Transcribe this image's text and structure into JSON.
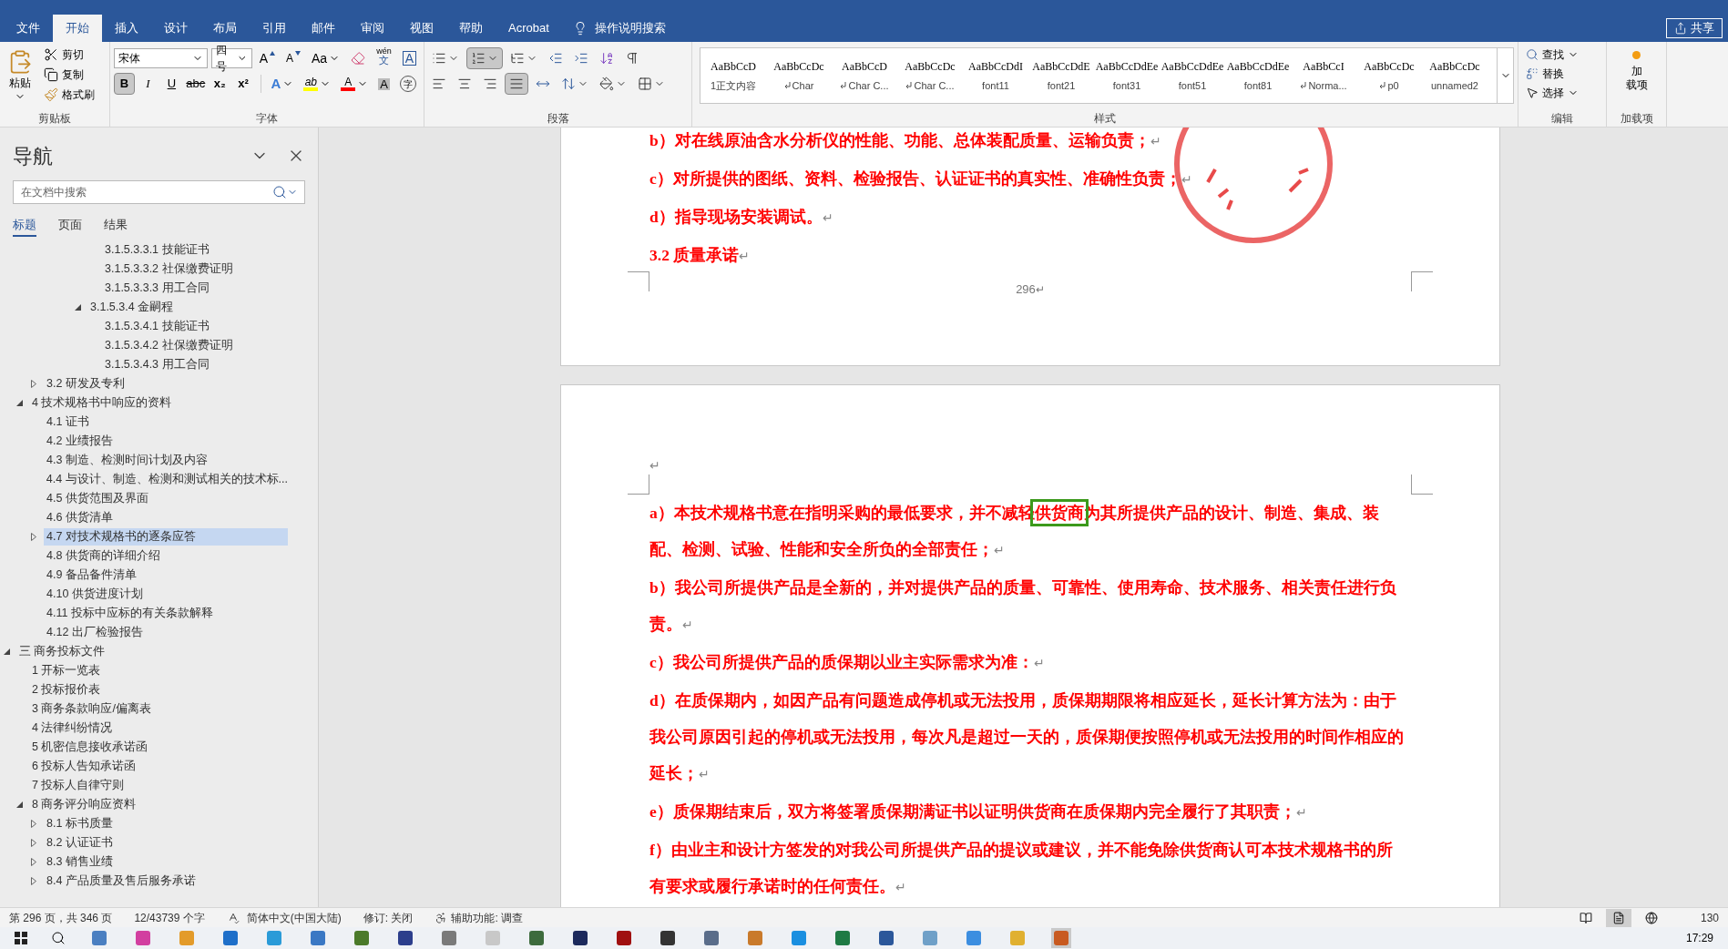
{
  "ribbon": {
    "tabs": [
      {
        "label": "文件",
        "selected": false
      },
      {
        "label": "开始",
        "selected": true
      },
      {
        "label": "插入",
        "selected": false
      },
      {
        "label": "设计",
        "selected": false
      },
      {
        "label": "布局",
        "selected": false
      },
      {
        "label": "引用",
        "selected": false
      },
      {
        "label": "邮件",
        "selected": false
      },
      {
        "label": "审阅",
        "selected": false
      },
      {
        "label": "视图",
        "selected": false
      },
      {
        "label": "帮助",
        "selected": false
      },
      {
        "label": "Acrobat",
        "selected": false
      }
    ],
    "tell_me": "操作说明搜索",
    "share": "共享",
    "clipboard": {
      "paste": "粘贴",
      "cut": "剪切",
      "copy": "复制",
      "format_painter": "格式刷",
      "label": "剪贴板"
    },
    "font": {
      "name": "宋体",
      "size": "四号",
      "grow": "A",
      "shrink": "A",
      "case": "Aa",
      "phonetic_top": "wén",
      "phonetic_bottom": "文",
      "boxed": "A",
      "label": "字体",
      "format_buttons": [
        {
          "kind": "bold",
          "glyph": "B",
          "selected": true
        },
        {
          "kind": "italic",
          "glyph": "I",
          "selected": false
        },
        {
          "kind": "underline",
          "glyph": "U",
          "selected": false
        },
        {
          "kind": "strike",
          "glyph": "abc",
          "selected": false
        },
        {
          "kind": "sub",
          "glyph": "x₂",
          "selected": false
        },
        {
          "kind": "sup",
          "glyph": "x²",
          "selected": false
        }
      ],
      "effects": [
        {
          "kind": "effect",
          "glyph": "A"
        },
        {
          "kind": "highlight",
          "glyph": "ab",
          "color": "#ffff00"
        },
        {
          "kind": "fontcolor",
          "glyph": "A",
          "color": "#ff0000"
        },
        {
          "kind": "shade",
          "glyph": "A"
        },
        {
          "kind": "enclose",
          "glyph": "字"
        }
      ]
    },
    "paragraph": {
      "label": "段落",
      "numbering_selected": true,
      "justify_selected": true
    },
    "styles": {
      "label": "样式",
      "items": [
        {
          "preview": "AaBbCcD",
          "name": "1正文内容",
          "linked": false
        },
        {
          "preview": "AaBbCcDc",
          "name": "Char",
          "linked": true
        },
        {
          "preview": "AaBbCcD",
          "name": "Char C...",
          "linked": true
        },
        {
          "preview": "AaBbCcDc",
          "name": "Char C...",
          "linked": true
        },
        {
          "preview": "AaBbCcDdI",
          "name": "font11",
          "linked": false
        },
        {
          "preview": "AaBbCcDdE",
          "name": "font21",
          "linked": false
        },
        {
          "preview": "AaBbCcDdEe",
          "name": "font31",
          "linked": false
        },
        {
          "preview": "AaBbCcDdEe",
          "name": "font51",
          "linked": false
        },
        {
          "preview": "AaBbCcDdEe",
          "name": "font81",
          "linked": false
        },
        {
          "preview": "AaBbCcI",
          "name": "Norma...",
          "linked": true
        },
        {
          "preview": "AaBbCcDc",
          "name": "p0",
          "linked": true
        },
        {
          "preview": "AaBbCcDc",
          "name": "unnamed2",
          "linked": false
        }
      ]
    },
    "editing": {
      "find": "查找",
      "replace": "替换",
      "select": "选择",
      "label": "编辑"
    },
    "addins": {
      "button_top": "加",
      "button_bottom": "载项",
      "label": "加载项"
    }
  },
  "nav": {
    "title": "导航",
    "search": {
      "placeholder": "在文档中搜索"
    },
    "tabs": [
      {
        "label": "标题",
        "selected": true
      },
      {
        "label": "页面",
        "selected": false
      },
      {
        "label": "结果",
        "selected": false
      }
    ],
    "tree": [
      {
        "children": [
          {
            "children": [
              {
                "children": [
                  {
                    "children": [
                      {
                        "children": [
                          {
                            "children": [
                              {
                                "label": "3.1.5.3.3.1 技能证书",
                                "selected": false
                              },
                              {
                                "label": "3.1.5.3.3.2 社保缴费证明",
                                "selected": false
                              },
                              {
                                "label": "3.1.5.3.3.3  用工合同",
                                "selected": false
                              }
                            ]
                          },
                          {
                            "label": "3.1.5.3.4 金嗣程",
                            "selected": false,
                            "expanded": true,
                            "children": [
                              {
                                "label": "3.1.5.3.4.1 技能证书",
                                "selected": false
                              },
                              {
                                "label": "3.1.5.3.4.2 社保缴费证明",
                                "selected": false
                              },
                              {
                                "label": "3.1.5.3.4.3 用工合同",
                                "selected": false
                              }
                            ]
                          }
                        ]
                      }
                    ]
                  }
                ]
              },
              {
                "label": "3.2 研发及专利",
                "selected": false,
                "expanded": false
              }
            ]
          },
          {
            "label": "4 技术规格书中响应的资料",
            "selected": false,
            "expanded": true,
            "children": [
              {
                "label": "4.1 证书",
                "selected": false
              },
              {
                "label": "4.2 业绩报告",
                "selected": false
              },
              {
                "label": "4.3 制造、检测时间计划及内容",
                "selected": false
              },
              {
                "label": "4.4 与设计、制造、检测和测试相关的技术标...",
                "selected": false
              },
              {
                "label": "4.5 供货范围及界面",
                "selected": false
              },
              {
                "label": "4.6 供货清单",
                "selected": false
              },
              {
                "label": "4.7 对技术规格书的逐条应答",
                "selected": true,
                "expanded": false
              },
              {
                "label": "4.8 供货商的详细介绍",
                "selected": false
              },
              {
                "label": "4.9 备品备件清单",
                "selected": false
              },
              {
                "label": "4.10 供货进度计划",
                "selected": false
              },
              {
                "label": "4.11 投标中应标的有关条款解释",
                "selected": false
              },
              {
                "label": "4.12 出厂检验报告",
                "selected": false
              }
            ]
          }
        ]
      },
      {
        "label": "三 商务投标文件",
        "selected": false,
        "expanded": true,
        "children": [
          {
            "label": "1 开标一览表",
            "selected": false
          },
          {
            "label": "2 投标报价表",
            "selected": false
          },
          {
            "label": "3 商务条款响应/偏离表",
            "selected": false
          },
          {
            "label": "4 法律纠纷情况",
            "selected": false
          },
          {
            "label": "5 机密信息接收承诺函",
            "selected": false
          },
          {
            "label": "6 投标人告知承诺函",
            "selected": false
          },
          {
            "label": "7 投标人自律守则",
            "selected": false
          },
          {
            "label": "8 商务评分响应资料",
            "selected": false,
            "expanded": true,
            "children": [
              {
                "label": "8.1 标书质量",
                "selected": false,
                "expanded": false
              },
              {
                "label": "8.2 认证证书",
                "selected": false,
                "expanded": false
              },
              {
                "label": "8.3 销售业绩",
                "selected": false,
                "expanded": false
              },
              {
                "label": "8.4 产品质量及售后服务承诺",
                "selected": false,
                "expanded": false
              }
            ]
          }
        ]
      }
    ]
  },
  "document": {
    "page_prev": {
      "paragraphs": [
        {
          "before": "b）对在线原油含水分析仪的性能、功能、总体装配质量、运输负责；",
          "end_mark": "↵"
        },
        {
          "before": "c）对所提供的图纸、资料、检验报告、认证证书的真实性、准确性负责；",
          "end_mark": "↵"
        },
        {
          "before": "d）指导现场安装调试。",
          "end_mark": "↵"
        },
        {
          "before": "3.2 质量承诺",
          "end_mark": "↵"
        }
      ],
      "page_number": "296",
      "page_number_mark": "↵"
    },
    "page_next": {
      "empty_mark": "↵",
      "paragraphs": [
        {
          "before": "a）本技术规格书意在指明采购的最低要求，并不减轻",
          "boxed": "供货商",
          "after": "为其所提供产品的设计、制造、集成、装配、检测、试验、性能和安全所负的全部责任；",
          "end_mark": "↵"
        },
        {
          "before": "b）我公司所提供产品是全新的，并对提供产品的质量、可靠性、使用寿命、技术服务、相关责任进行负责。",
          "end_mark": "↵"
        },
        {
          "before": "c）我公司所提供产品的质保期以业主实际需求为准：",
          "end_mark": "↵"
        },
        {
          "before": "d）在质保期内，如因产品有问题造成停机或无法投用，质保期期限将相应延长，延长计算方法为：由于我公司原因引起的停机或无法投用，每次凡是超过一天的，质保期便按照停机或无法投用的时间作相应的延长；",
          "end_mark": "↵"
        },
        {
          "before": "e）质保期结束后，双方将签署质保期满证书以证明供货商在质保期内完全履行了其职责；",
          "end_mark": "↵"
        },
        {
          "before": "f）由业主和设计方签发的对我公司所提供产品的提议或建议，并不能免除供货商认可本技术规格书的所有要求或履行承诺时的任何责任。",
          "end_mark": "↵"
        }
      ]
    }
  },
  "status_bar": {
    "page": "第 296 页，共 346 页",
    "words": "12/43739 个字",
    "language": "简体中文(中国大陆)",
    "track_changes": "修订: 关闭",
    "accessibility": "辅助功能: 调查",
    "zoom": "130",
    "views": [
      {
        "kind": "read",
        "selected": false
      },
      {
        "kind": "print",
        "selected": true
      },
      {
        "kind": "web",
        "selected": false
      }
    ]
  },
  "taskbar": {
    "time": "17:29",
    "apps": [
      {
        "color": "#4a7fc1",
        "selected": false
      },
      {
        "color": "#d23fa0",
        "selected": false
      },
      {
        "color": "#e39b2a",
        "selected": false
      },
      {
        "color": "#1e6fc9",
        "selected": false
      },
      {
        "color": "#2a9bd8",
        "selected": false
      },
      {
        "color": "#3a78c4",
        "selected": false
      },
      {
        "color": "#4b7a2a",
        "selected": false
      },
      {
        "color": "#2c3e8c",
        "selected": false
      },
      {
        "color": "#7a7a7a",
        "selected": false
      },
      {
        "color": "#c8c8c8",
        "selected": false
      },
      {
        "color": "#3d6b3d",
        "selected": false
      },
      {
        "color": "#1c2a5c",
        "selected": false
      },
      {
        "color": "#a01010",
        "selected": false
      },
      {
        "color": "#333333",
        "selected": false
      },
      {
        "color": "#5a6d8a",
        "selected": false
      },
      {
        "color": "#c97a2b",
        "selected": false
      },
      {
        "color": "#1a8fe0",
        "selected": false
      },
      {
        "color": "#1f7a44",
        "selected": false
      },
      {
        "color": "#2b579a",
        "selected": false
      },
      {
        "color": "#6fa0c8",
        "selected": false
      },
      {
        "color": "#3c8ee0",
        "selected": false
      },
      {
        "color": "#e0b030",
        "selected": false
      },
      {
        "color": "#c85a20",
        "selected": true
      }
    ]
  }
}
